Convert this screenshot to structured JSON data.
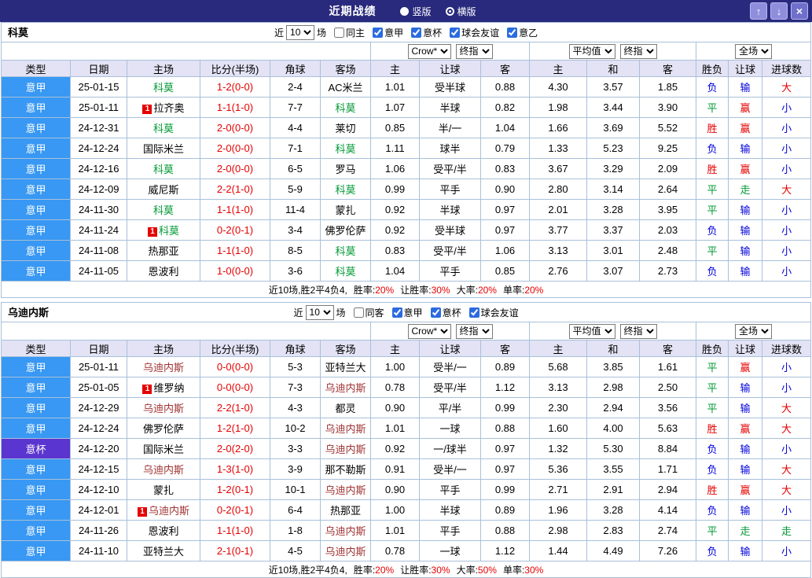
{
  "titlebar": {
    "title": "近期战绩",
    "modes": [
      {
        "label": "竖版",
        "selected": false
      },
      {
        "label": "横版",
        "selected": true
      }
    ],
    "buttons": {
      "up": "↑",
      "down": "↓",
      "close": "×"
    }
  },
  "colors": {
    "titlebar_bg": "#29297d",
    "header_bg": "#e3e3f5",
    "grid_border": "#a9c0da",
    "league_serie_a": "#3898f3",
    "league_cup": "#5b35cf",
    "win_red": "#e60000",
    "lose_blue": "#0000dd",
    "push_green": "#009933",
    "como_team": "#009933",
    "udinese_team": "#a03333"
  },
  "sections": [
    {
      "team": "科莫",
      "team_color": "#009933",
      "filter": {
        "prefix": "近",
        "count": "10",
        "suffix": "场",
        "checkboxes": [
          {
            "label": "同主",
            "checked": false
          },
          {
            "label": "意甲",
            "checked": true
          },
          {
            "label": "意杯",
            "checked": true
          },
          {
            "label": "球会友谊",
            "checked": true
          },
          {
            "label": "意乙",
            "checked": true
          }
        ]
      },
      "selects": [
        "Crow*",
        "终指",
        "平均值",
        "终指",
        "全场"
      ],
      "columns": [
        "类型",
        "日期",
        "主场",
        "比分(半场)",
        "角球",
        "客场",
        "主",
        "让球",
        "客",
        "主",
        "和",
        "客",
        "胜负",
        "让球",
        "进球数"
      ],
      "rows": [
        {
          "league": "意甲",
          "date": "25-01-15",
          "home": "科莫",
          "home_subject": true,
          "home_badge": "",
          "score": "1-2(0-0)",
          "corners": "2-4",
          "away": "AC米兰",
          "away_subject": false,
          "away_badge": "",
          "odds": [
            "1.01",
            "受半球",
            "0.88"
          ],
          "avg": [
            "4.30",
            "3.57",
            "1.85"
          ],
          "results": [
            "负",
            "输",
            "大"
          ]
        },
        {
          "league": "意甲",
          "date": "25-01-11",
          "home": "拉齐奥",
          "home_subject": false,
          "home_badge": "1",
          "score": "1-1(1-0)",
          "corners": "7-7",
          "away": "科莫",
          "away_subject": true,
          "away_badge": "",
          "odds": [
            "1.07",
            "半球",
            "0.82"
          ],
          "avg": [
            "1.98",
            "3.44",
            "3.90"
          ],
          "results": [
            "平",
            "赢",
            "小"
          ]
        },
        {
          "league": "意甲",
          "date": "24-12-31",
          "home": "科莫",
          "home_subject": true,
          "home_badge": "",
          "score": "2-0(0-0)",
          "corners": "4-4",
          "away": "莱切",
          "away_subject": false,
          "away_badge": "",
          "odds": [
            "0.85",
            "半/一",
            "1.04"
          ],
          "avg": [
            "1.66",
            "3.69",
            "5.52"
          ],
          "results": [
            "胜",
            "赢",
            "小"
          ]
        },
        {
          "league": "意甲",
          "date": "24-12-24",
          "home": "国际米兰",
          "home_subject": false,
          "home_badge": "",
          "score": "2-0(0-0)",
          "corners": "7-1",
          "away": "科莫",
          "away_subject": true,
          "away_badge": "",
          "odds": [
            "1.11",
            "球半",
            "0.79"
          ],
          "avg": [
            "1.33",
            "5.23",
            "9.25"
          ],
          "results": [
            "负",
            "输",
            "小"
          ]
        },
        {
          "league": "意甲",
          "date": "24-12-16",
          "home": "科莫",
          "home_subject": true,
          "home_badge": "",
          "score": "2-0(0-0)",
          "corners": "6-5",
          "away": "罗马",
          "away_subject": false,
          "away_badge": "",
          "odds": [
            "1.06",
            "受平/半",
            "0.83"
          ],
          "avg": [
            "3.67",
            "3.29",
            "2.09"
          ],
          "results": [
            "胜",
            "赢",
            "小"
          ]
        },
        {
          "league": "意甲",
          "date": "24-12-09",
          "home": "威尼斯",
          "home_subject": false,
          "home_badge": "",
          "score": "2-2(1-0)",
          "corners": "5-9",
          "away": "科莫",
          "away_subject": true,
          "away_badge": "",
          "odds": [
            "0.99",
            "平手",
            "0.90"
          ],
          "avg": [
            "2.80",
            "3.14",
            "2.64"
          ],
          "results": [
            "平",
            "走",
            "大"
          ]
        },
        {
          "league": "意甲",
          "date": "24-11-30",
          "home": "科莫",
          "home_subject": true,
          "home_badge": "",
          "score": "1-1(1-0)",
          "corners": "11-4",
          "away": "蒙扎",
          "away_subject": false,
          "away_badge": "",
          "odds": [
            "0.92",
            "半球",
            "0.97"
          ],
          "avg": [
            "2.01",
            "3.28",
            "3.95"
          ],
          "results": [
            "平",
            "输",
            "小"
          ]
        },
        {
          "league": "意甲",
          "date": "24-11-24",
          "home": "科莫",
          "home_subject": true,
          "home_badge": "1",
          "score": "0-2(0-1)",
          "corners": "3-4",
          "away": "佛罗伦萨",
          "away_subject": false,
          "away_badge": "",
          "odds": [
            "0.92",
            "受半球",
            "0.97"
          ],
          "avg": [
            "3.77",
            "3.37",
            "2.03"
          ],
          "results": [
            "负",
            "输",
            "小"
          ]
        },
        {
          "league": "意甲",
          "date": "24-11-08",
          "home": "热那亚",
          "home_subject": false,
          "home_badge": "",
          "score": "1-1(1-0)",
          "corners": "8-5",
          "away": "科莫",
          "away_subject": true,
          "away_badge": "",
          "odds": [
            "0.83",
            "受平/半",
            "1.06"
          ],
          "avg": [
            "3.13",
            "3.01",
            "2.48"
          ],
          "results": [
            "平",
            "输",
            "小"
          ]
        },
        {
          "league": "意甲",
          "date": "24-11-05",
          "home": "恩波利",
          "home_subject": false,
          "home_badge": "",
          "score": "1-0(0-0)",
          "corners": "3-6",
          "away": "科莫",
          "away_subject": true,
          "away_badge": "",
          "odds": [
            "1.04",
            "平手",
            "0.85"
          ],
          "avg": [
            "2.76",
            "3.07",
            "2.73"
          ],
          "results": [
            "负",
            "输",
            "小"
          ]
        }
      ],
      "summary": {
        "text": "近10场,胜2平4负4,",
        "stats": [
          {
            "label": "胜率:",
            "value": "20%"
          },
          {
            "label": "让胜率:",
            "value": "30%"
          },
          {
            "label": "大率:",
            "value": "20%"
          },
          {
            "label": "单率:",
            "value": "20%"
          }
        ]
      }
    },
    {
      "team": "乌迪内斯",
      "team_color": "#a03333",
      "filter": {
        "prefix": "近",
        "count": "10",
        "suffix": "场",
        "checkboxes": [
          {
            "label": "同客",
            "checked": false
          },
          {
            "label": "意甲",
            "checked": true
          },
          {
            "label": "意杯",
            "checked": true
          },
          {
            "label": "球会友谊",
            "checked": true
          }
        ]
      },
      "selects": [
        "Crow*",
        "终指",
        "平均值",
        "终指",
        "全场"
      ],
      "columns": [
        "类型",
        "日期",
        "主场",
        "比分(半场)",
        "角球",
        "客场",
        "主",
        "让球",
        "客",
        "主",
        "和",
        "客",
        "胜负",
        "让球",
        "进球数"
      ],
      "rows": [
        {
          "league": "意甲",
          "date": "25-01-11",
          "home": "乌迪内斯",
          "home_subject": true,
          "home_badge": "",
          "score": "0-0(0-0)",
          "corners": "5-3",
          "away": "亚特兰大",
          "away_subject": false,
          "away_badge": "",
          "odds": [
            "1.00",
            "受半/一",
            "0.89"
          ],
          "avg": [
            "5.68",
            "3.85",
            "1.61"
          ],
          "results": [
            "平",
            "赢",
            "小"
          ]
        },
        {
          "league": "意甲",
          "date": "25-01-05",
          "home": "维罗纳",
          "home_subject": false,
          "home_badge": "1",
          "score": "0-0(0-0)",
          "corners": "7-3",
          "away": "乌迪内斯",
          "away_subject": true,
          "away_badge": "",
          "odds": [
            "0.78",
            "受平/半",
            "1.12"
          ],
          "avg": [
            "3.13",
            "2.98",
            "2.50"
          ],
          "results": [
            "平",
            "输",
            "小"
          ]
        },
        {
          "league": "意甲",
          "date": "24-12-29",
          "home": "乌迪内斯",
          "home_subject": true,
          "home_badge": "",
          "score": "2-2(1-0)",
          "corners": "4-3",
          "away": "都灵",
          "away_subject": false,
          "away_badge": "",
          "odds": [
            "0.90",
            "平/半",
            "0.99"
          ],
          "avg": [
            "2.30",
            "2.94",
            "3.56"
          ],
          "results": [
            "平",
            "输",
            "大"
          ]
        },
        {
          "league": "意甲",
          "date": "24-12-24",
          "home": "佛罗伦萨",
          "home_subject": false,
          "home_badge": "",
          "score": "1-2(1-0)",
          "corners": "10-2",
          "away": "乌迪内斯",
          "away_subject": true,
          "away_badge": "",
          "odds": [
            "1.01",
            "一球",
            "0.88"
          ],
          "avg": [
            "1.60",
            "4.00",
            "5.63"
          ],
          "results": [
            "胜",
            "赢",
            "大"
          ]
        },
        {
          "league": "意杯",
          "date": "24-12-20",
          "home": "国际米兰",
          "home_subject": false,
          "home_badge": "",
          "score": "2-0(2-0)",
          "corners": "3-3",
          "away": "乌迪内斯",
          "away_subject": true,
          "away_badge": "",
          "odds": [
            "0.92",
            "一/球半",
            "0.97"
          ],
          "avg": [
            "1.32",
            "5.30",
            "8.84"
          ],
          "results": [
            "负",
            "输",
            "小"
          ]
        },
        {
          "league": "意甲",
          "date": "24-12-15",
          "home": "乌迪内斯",
          "home_subject": true,
          "home_badge": "",
          "score": "1-3(1-0)",
          "corners": "3-9",
          "away": "那不勒斯",
          "away_subject": false,
          "away_badge": "",
          "odds": [
            "0.91",
            "受半/一",
            "0.97"
          ],
          "avg": [
            "5.36",
            "3.55",
            "1.71"
          ],
          "results": [
            "负",
            "输",
            "大"
          ]
        },
        {
          "league": "意甲",
          "date": "24-12-10",
          "home": "蒙扎",
          "home_subject": false,
          "home_badge": "",
          "score": "1-2(0-1)",
          "corners": "10-1",
          "away": "乌迪内斯",
          "away_subject": true,
          "away_badge": "",
          "odds": [
            "0.90",
            "平手",
            "0.99"
          ],
          "avg": [
            "2.71",
            "2.91",
            "2.94"
          ],
          "results": [
            "胜",
            "赢",
            "大"
          ]
        },
        {
          "league": "意甲",
          "date": "24-12-01",
          "home": "乌迪内斯",
          "home_subject": true,
          "home_badge": "1",
          "score": "0-2(0-1)",
          "corners": "6-4",
          "away": "热那亚",
          "away_subject": false,
          "away_badge": "",
          "odds": [
            "1.00",
            "半球",
            "0.89"
          ],
          "avg": [
            "1.96",
            "3.28",
            "4.14"
          ],
          "results": [
            "负",
            "输",
            "小"
          ]
        },
        {
          "league": "意甲",
          "date": "24-11-26",
          "home": "恩波利",
          "home_subject": false,
          "home_badge": "",
          "score": "1-1(1-0)",
          "corners": "1-8",
          "away": "乌迪内斯",
          "away_subject": true,
          "away_badge": "",
          "odds": [
            "1.01",
            "平手",
            "0.88"
          ],
          "avg": [
            "2.98",
            "2.83",
            "2.74"
          ],
          "results": [
            "平",
            "走",
            "走"
          ]
        },
        {
          "league": "意甲",
          "date": "24-11-10",
          "home": "亚特兰大",
          "home_subject": false,
          "home_badge": "",
          "score": "2-1(0-1)",
          "corners": "4-5",
          "away": "乌迪内斯",
          "away_subject": true,
          "away_badge": "",
          "odds": [
            "0.78",
            "一球",
            "1.12"
          ],
          "avg": [
            "1.44",
            "4.49",
            "7.26"
          ],
          "results": [
            "负",
            "输",
            "小"
          ]
        }
      ],
      "summary": {
        "text": "近10场,胜2平4负4,",
        "stats": [
          {
            "label": "胜率:",
            "value": "20%"
          },
          {
            "label": "让胜率:",
            "value": "30%"
          },
          {
            "label": "大率:",
            "value": "50%"
          },
          {
            "label": "单率:",
            "value": "30%"
          }
        ]
      }
    }
  ]
}
